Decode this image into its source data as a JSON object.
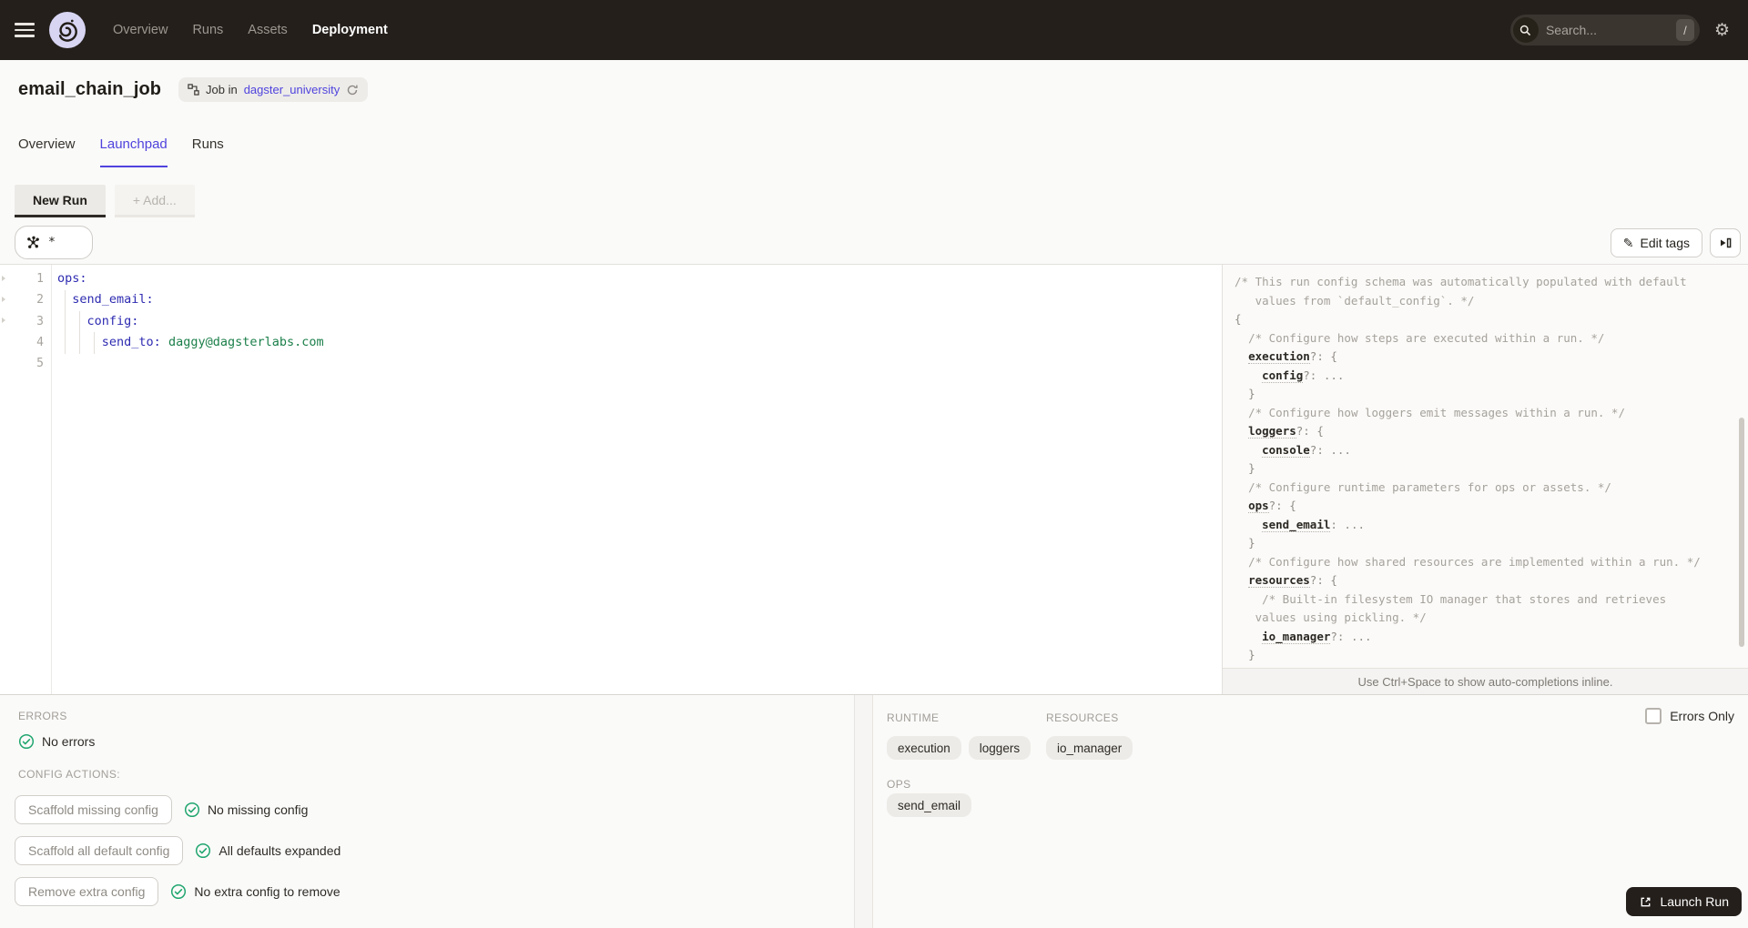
{
  "colors": {
    "accent": "#4F43DD",
    "success": "#21A66F",
    "nav_bg": "#241F1B",
    "key": "#2E2BB1",
    "value_green": "#1B7F4A"
  },
  "nav": {
    "items": [
      "Overview",
      "Runs",
      "Assets",
      "Deployment"
    ],
    "search_placeholder": "Search...",
    "search_shortcut": "/"
  },
  "header": {
    "title": "email_chain_job",
    "badge_prefix": "Job in",
    "badge_link": "dagster_university"
  },
  "tabs": [
    "Overview",
    "Launchpad",
    "Runs"
  ],
  "launchpad": {
    "config_tabs": [
      "New Run",
      "+ Add..."
    ],
    "op_selector": "*",
    "edit_tags_label": "Edit tags",
    "editor": {
      "lines": [
        [
          [
            "k",
            "ops:"
          ]
        ],
        [
          [
            "w",
            "  "
          ],
          [
            "k",
            "send_email:"
          ]
        ],
        [
          [
            "w",
            "    "
          ],
          [
            "k",
            "config:"
          ]
        ],
        [
          [
            "w",
            "      "
          ],
          [
            "k",
            "send_to:"
          ],
          [
            "w",
            " "
          ],
          [
            "v",
            "daggy@dagsterlabs.com"
          ]
        ],
        []
      ]
    },
    "schema": {
      "lines": [
        [
          [
            "c",
            "/* This run config schema was automatically populated with default"
          ]
        ],
        [
          [
            "c",
            "   values from `default_config`. */"
          ]
        ],
        [
          [
            "g",
            "{"
          ]
        ],
        [
          [
            "w",
            "  "
          ],
          [
            "c",
            "/* Configure how steps are executed within a run. */"
          ]
        ],
        [
          [
            "w",
            "  "
          ],
          [
            "sk",
            "execution"
          ],
          [
            "g",
            "?: {"
          ]
        ],
        [
          [
            "w",
            "    "
          ],
          [
            "sk",
            "config"
          ],
          [
            "g",
            "?: ..."
          ]
        ],
        [
          [
            "w",
            "  "
          ],
          [
            "g",
            "}"
          ]
        ],
        [
          [
            "w",
            "  "
          ],
          [
            "c",
            "/* Configure how loggers emit messages within a run. */"
          ]
        ],
        [
          [
            "w",
            "  "
          ],
          [
            "sk",
            "loggers"
          ],
          [
            "g",
            "?: {"
          ]
        ],
        [
          [
            "w",
            "    "
          ],
          [
            "sk",
            "console"
          ],
          [
            "g",
            "?: ..."
          ]
        ],
        [
          [
            "w",
            "  "
          ],
          [
            "g",
            "}"
          ]
        ],
        [
          [
            "w",
            "  "
          ],
          [
            "c",
            "/* Configure runtime parameters for ops or assets. */"
          ]
        ],
        [
          [
            "w",
            "  "
          ],
          [
            "sk",
            "ops"
          ],
          [
            "g",
            "?: {"
          ]
        ],
        [
          [
            "w",
            "    "
          ],
          [
            "sk",
            "send_email"
          ],
          [
            "g",
            ": ..."
          ]
        ],
        [
          [
            "w",
            "  "
          ],
          [
            "g",
            "}"
          ]
        ],
        [
          [
            "w",
            "  "
          ],
          [
            "c",
            "/* Configure how shared resources are implemented within a run. */"
          ]
        ],
        [
          [
            "w",
            "  "
          ],
          [
            "sk",
            "resources"
          ],
          [
            "g",
            "?: {"
          ]
        ],
        [
          [
            "w",
            "    "
          ],
          [
            "c",
            "/* Built-in filesystem IO manager that stores and retrieves"
          ]
        ],
        [
          [
            "w",
            "   "
          ],
          [
            "c",
            "values using pickling. */"
          ]
        ],
        [
          [
            "w",
            "    "
          ],
          [
            "sk",
            "io_manager"
          ],
          [
            "g",
            "?: ..."
          ]
        ],
        [
          [
            "w",
            "  "
          ],
          [
            "g",
            "}"
          ]
        ]
      ]
    },
    "hint": "Use Ctrl+Space to show auto-completions inline."
  },
  "bottom": {
    "errors_label": "ERRORS",
    "no_errors": "No errors",
    "config_actions_label": "CONFIG ACTIONS:",
    "actions": [
      {
        "button": "Scaffold missing config",
        "status": "No missing config"
      },
      {
        "button": "Scaffold all default config",
        "status": "All defaults expanded"
      },
      {
        "button": "Remove extra config",
        "status": "No extra config to remove"
      }
    ],
    "runtime_label": "RUNTIME",
    "runtime_tags": [
      "execution",
      "loggers"
    ],
    "resources_label": "RESOURCES",
    "resources_tags": [
      "io_manager"
    ],
    "ops_label": "OPS",
    "ops_tags": [
      "send_email"
    ],
    "errors_only_label": "Errors Only",
    "launch_label": "Launch Run"
  }
}
